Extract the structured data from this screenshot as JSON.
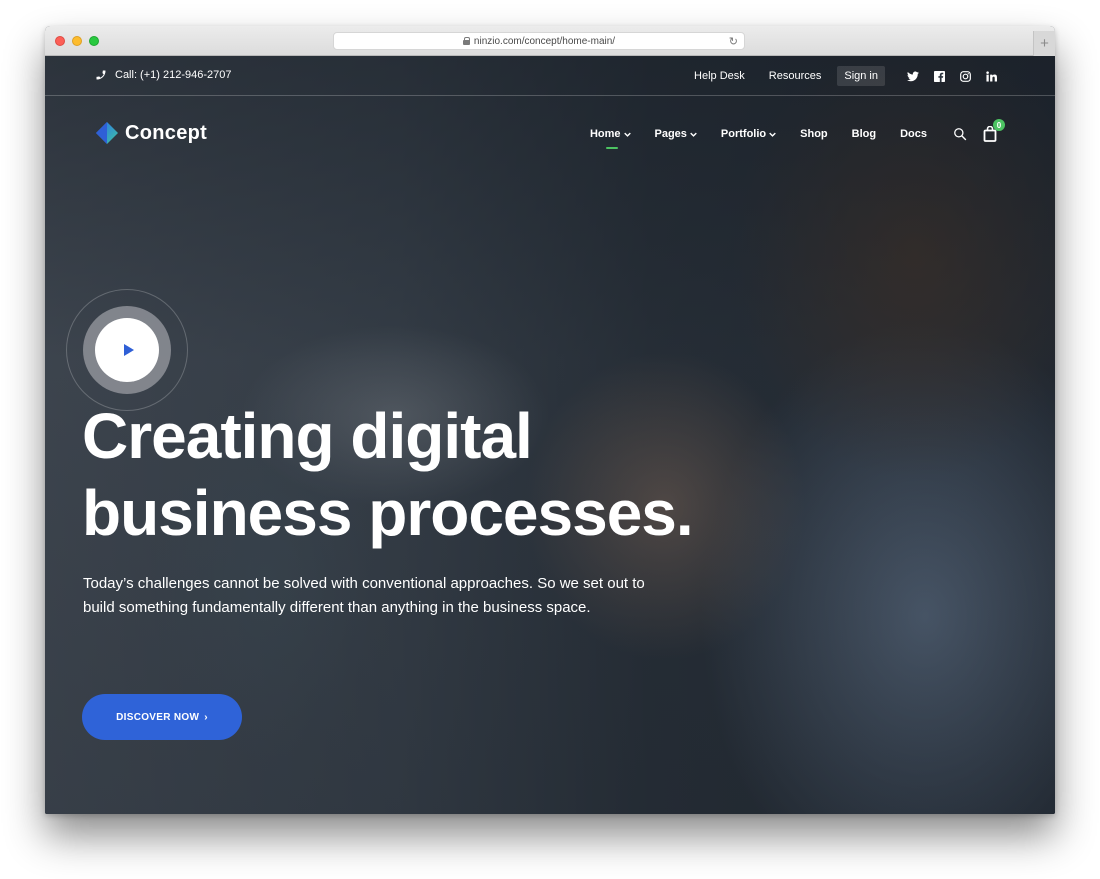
{
  "browser": {
    "url": "ninzio.com/concept/home-main/",
    "reload_icon": "↻",
    "new_tab_icon": "+"
  },
  "topbar": {
    "phone_icon": "phone-icon",
    "call_text": "Call: (+1) 212-946-2707",
    "links": [
      {
        "label": "Help Desk"
      },
      {
        "label": "Resources"
      },
      {
        "label": "Sign in"
      }
    ],
    "socials": [
      "twitter-icon",
      "facebook-icon",
      "instagram-icon",
      "linkedin-icon"
    ]
  },
  "nav": {
    "logo_text": "Concept",
    "items": [
      {
        "label": "Home",
        "dropdown": true,
        "active": true
      },
      {
        "label": "Pages",
        "dropdown": true
      },
      {
        "label": "Portfolio",
        "dropdown": true
      },
      {
        "label": "Shop"
      },
      {
        "label": "Blog"
      },
      {
        "label": "Docs"
      }
    ],
    "cart_count": "0",
    "accent_color": "#4cc362"
  },
  "hero": {
    "headline_lines": [
      "Creating digital",
      "business processes."
    ],
    "subtext_lines": [
      "Today’s challenges cannot be solved with conventional approaches. So we set out to",
      "build something fundamentally different than anything in the business space."
    ],
    "cta_label": "DISCOVER NOW",
    "cta_arrow": "›",
    "cta_color": "#2f63d8"
  }
}
